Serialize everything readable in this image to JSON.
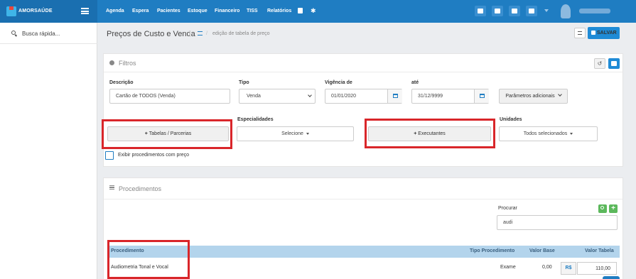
{
  "app": {
    "brand": "AMORSAÚDE"
  },
  "nav": {
    "items": [
      "Agenda",
      "Espera",
      "Pacientes",
      "Estoque",
      "Financeiro",
      "TISS",
      "Relatórios"
    ]
  },
  "sidebar": {
    "search_label": "Busca rápida..."
  },
  "header": {
    "title": "Preços de Custo e Venda",
    "breadcrumb": "edição de tabela de preço",
    "save_label": "SALVAR"
  },
  "filters": {
    "title": "Filtros",
    "descricao_label": "Descrição",
    "descricao_value": "Cartão de TODOS (Venda)",
    "tipo_label": "Tipo",
    "tipo_value": "Venda",
    "vigencia_label": "Vigência de",
    "vigencia_value": "01/01/2020",
    "ate_label": "até",
    "ate_value": "31/12/9999",
    "parametros_label": "Parâmetros adicionais",
    "tabelas_label": "Tabelas / Parcerias",
    "especialidades_label": "Especialidades",
    "especialidades_value": "Selecione",
    "executantes_label": "Executantes",
    "unidades_label": "Unidades",
    "unidades_value": "Todos selecionados",
    "exibir_label": "Exibir procedimentos com preço"
  },
  "procedures": {
    "title": "Procedimentos",
    "search_label": "Procurar",
    "search_value": "audi",
    "columns": {
      "procedimento": "Procedimento",
      "tipo": "Tipo Procedimento",
      "valor_base": "Valor Base",
      "valor_tabela": "Valor Tabela"
    },
    "rows": [
      {
        "procedimento": "Audiometria Tonal e Vocal",
        "tipo": "Exame",
        "valor_base": "0,00",
        "currency": "R$",
        "valor_tabela": "110,00"
      }
    ]
  },
  "colors": {
    "nav": "#1f7dc2",
    "highlight": "#d9262a",
    "table_header": "#b3d4ec"
  }
}
